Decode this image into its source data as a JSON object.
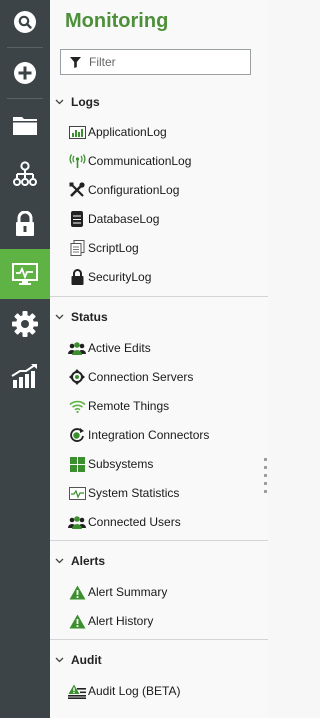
{
  "rail": {
    "items": [
      {
        "icon": "search-icon"
      },
      {
        "icon": "add-icon"
      },
      {
        "icon": "folder-icon"
      },
      {
        "icon": "network-icon"
      },
      {
        "icon": "lock-icon"
      },
      {
        "icon": "monitor-icon",
        "active": true
      },
      {
        "icon": "gear-icon"
      },
      {
        "icon": "analytics-icon"
      }
    ],
    "active_color": "#5fb244",
    "background_color": "#3c4447"
  },
  "panel": {
    "title": "Monitoring",
    "title_color": "#4e8f3a",
    "filter": {
      "placeholder": "Filter",
      "value": ""
    },
    "sections": [
      {
        "label": "Logs",
        "items": [
          {
            "label": "ApplicationLog",
            "icon": "application-log-icon"
          },
          {
            "label": "CommunicationLog",
            "icon": "communication-log-icon"
          },
          {
            "label": "ConfigurationLog",
            "icon": "configuration-log-icon"
          },
          {
            "label": "DatabaseLog",
            "icon": "database-log-icon"
          },
          {
            "label": "ScriptLog",
            "icon": "script-log-icon"
          },
          {
            "label": "SecurityLog",
            "icon": "security-log-icon"
          }
        ]
      },
      {
        "label": "Status",
        "items": [
          {
            "label": "Active Edits",
            "icon": "users-icon"
          },
          {
            "label": "Connection Servers",
            "icon": "connection-servers-icon"
          },
          {
            "label": "Remote Things",
            "icon": "wifi-icon"
          },
          {
            "label": "Integration Connectors",
            "icon": "integration-icon"
          },
          {
            "label": "Subsystems",
            "icon": "subsystems-icon"
          },
          {
            "label": "System Statistics",
            "icon": "system-statistics-icon"
          },
          {
            "label": "Connected Users",
            "icon": "users-icon"
          }
        ]
      },
      {
        "label": "Alerts",
        "items": [
          {
            "label": "Alert Summary",
            "icon": "warning-icon"
          },
          {
            "label": "Alert History",
            "icon": "warning-icon"
          }
        ]
      },
      {
        "label": "Audit",
        "items": [
          {
            "label": "Audit Log (BETA)",
            "icon": "audit-log-icon"
          }
        ]
      }
    ]
  }
}
